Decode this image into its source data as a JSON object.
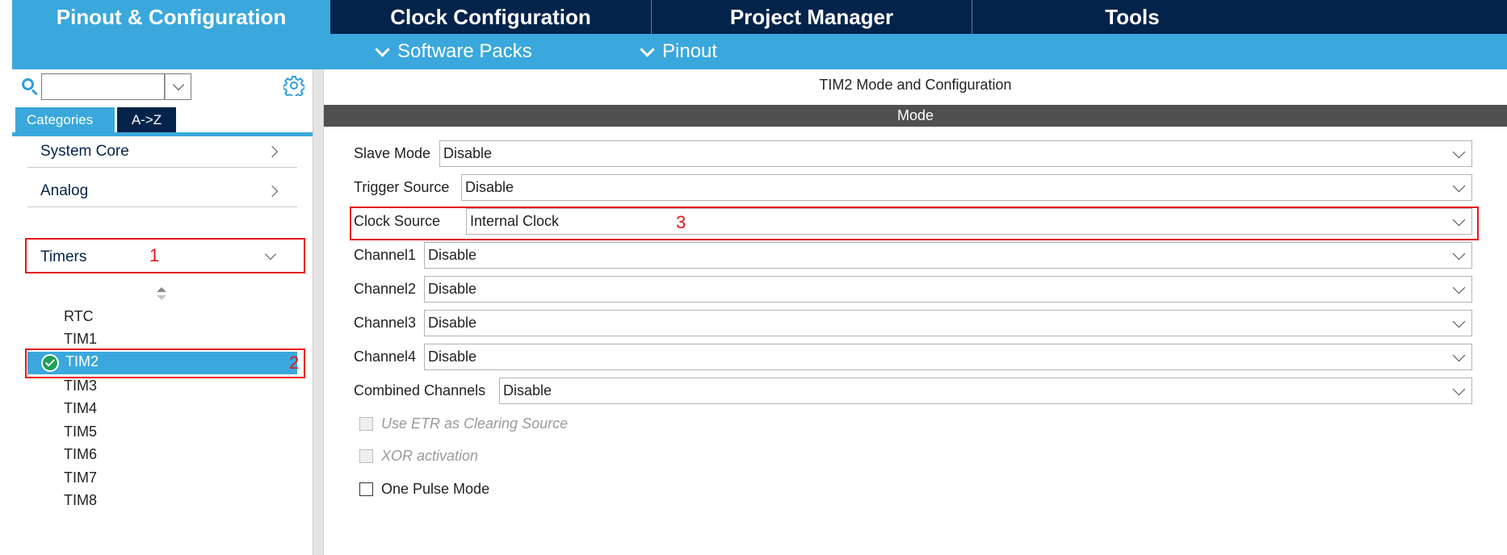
{
  "top_tabs": [
    "Pinout & Configuration",
    "Clock Configuration",
    "Project Manager",
    "Tools"
  ],
  "sub_bar": {
    "software_packs": "Software Packs",
    "pinout": "Pinout"
  },
  "search": {
    "value": "",
    "placeholder": ""
  },
  "category_tabs": {
    "categories": "Categories",
    "az": "A->Z"
  },
  "categories": [
    {
      "label": "System Core",
      "expanded": false
    },
    {
      "label": "Analog",
      "expanded": false
    },
    {
      "label": "Timers",
      "expanded": true
    }
  ],
  "timers": {
    "items": [
      "RTC",
      "TIM1",
      "TIM2",
      "TIM3",
      "TIM4",
      "TIM5",
      "TIM6",
      "TIM7",
      "TIM8"
    ],
    "selected": "TIM2"
  },
  "annotations": {
    "timers": "1",
    "tim2": "2",
    "clock_source": "3"
  },
  "right": {
    "title": "TIM2 Mode and Configuration",
    "mode_header": "Mode",
    "fields": [
      {
        "label": "Slave Mode",
        "value": "Disable"
      },
      {
        "label": "Trigger Source",
        "value": "Disable"
      },
      {
        "label": "Clock Source",
        "value": "Internal Clock"
      },
      {
        "label": "Channel1",
        "value": "Disable"
      },
      {
        "label": "Channel2",
        "value": "Disable"
      },
      {
        "label": "Channel3",
        "value": "Disable"
      },
      {
        "label": "Channel4",
        "value": "Disable"
      },
      {
        "label": "Combined Channels",
        "value": "Disable"
      }
    ],
    "checkboxes": [
      {
        "label": "Use ETR as Clearing Source",
        "disabled": true,
        "checked": false
      },
      {
        "label": "XOR activation",
        "disabled": true,
        "checked": false
      },
      {
        "label": "One Pulse Mode",
        "disabled": false,
        "checked": false
      }
    ]
  },
  "colors": {
    "navy": "#03234b",
    "accent": "#3aa8dc",
    "annotation": "#e8141b",
    "mode_bar": "#505050",
    "check": "#1f9e5a"
  }
}
